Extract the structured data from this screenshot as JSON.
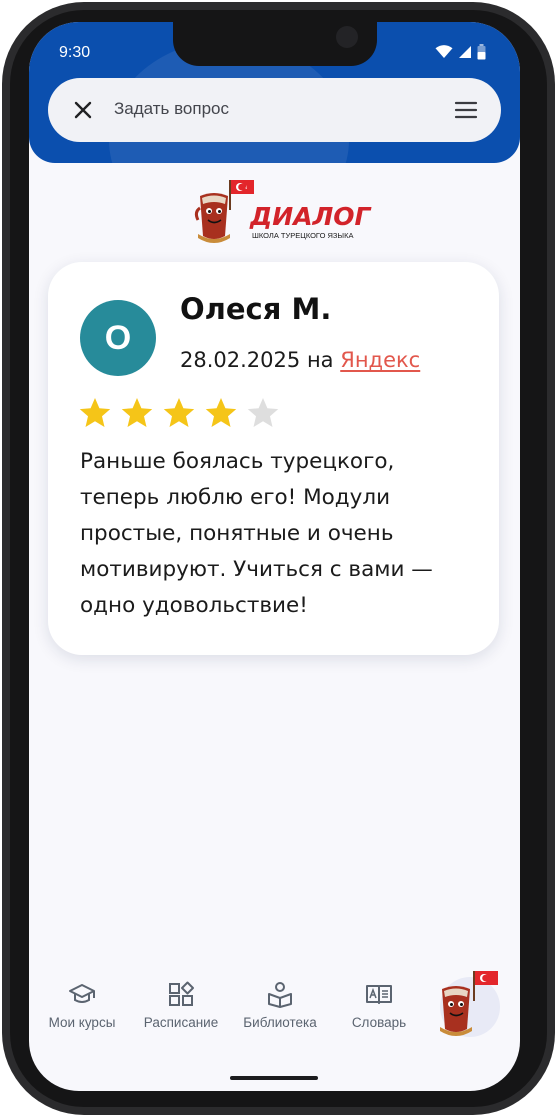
{
  "status_bar": {
    "time": "9:30"
  },
  "search": {
    "placeholder": "Задать вопрос"
  },
  "logo": {
    "title": "ДИАЛОГ",
    "subtitle": "ШКОЛА ТУРЕЦКОГО ЯЗЫКА"
  },
  "review": {
    "avatar_initial": "О",
    "author": "Олеся М.",
    "date": "28.02.2025",
    "connector": "на",
    "source": "Яндекс",
    "rating": 4,
    "max_rating": 5,
    "text": "Раньше боялась турецкого, теперь люблю его! Модули простые, понятные и очень мотивируют. Учиться с вами — одно удовольствие!"
  },
  "nav": {
    "items": [
      {
        "label": "Мои курсы",
        "icon": "graduation-cap-icon"
      },
      {
        "label": "Расписание",
        "icon": "widgets-icon"
      },
      {
        "label": "Библиотека",
        "icon": "reader-icon"
      },
      {
        "label": "Словарь",
        "icon": "dictionary-book-icon"
      }
    ],
    "assistant_icon": "mascot-icon"
  },
  "colors": {
    "header": "#0b4fae",
    "avatar": "#278b9a",
    "link": "#e2574c",
    "star_filled": "#f5c518",
    "star_empty": "#dedede",
    "logo_red": "#d2232a"
  }
}
